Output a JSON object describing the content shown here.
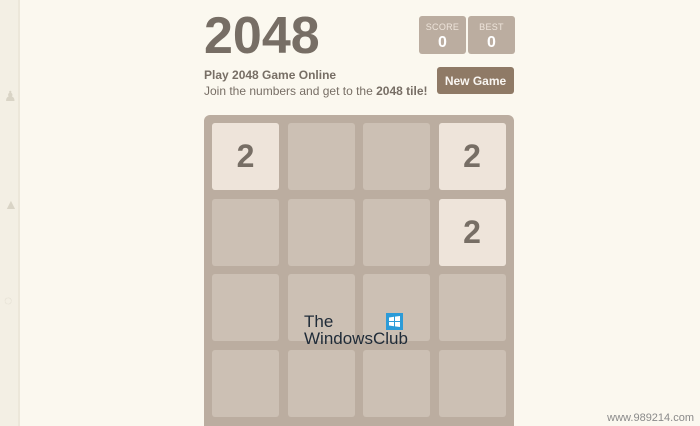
{
  "header": {
    "title": "2048",
    "score_label": "SCORE",
    "score_value": "0",
    "best_label": "BEST",
    "best_value": "0",
    "subtitle": "Play 2048 Game Online",
    "intro_prefix": "Join the numbers and get to the ",
    "intro_bold": "2048 tile!",
    "new_game_label": "New Game"
  },
  "board": {
    "rows": 4,
    "cols": 4,
    "tiles": [
      {
        "row": 0,
        "col": 0,
        "value": "2"
      },
      {
        "row": 0,
        "col": 3,
        "value": "2"
      },
      {
        "row": 1,
        "col": 3,
        "value": "2"
      }
    ]
  },
  "watermark": {
    "line1": "The",
    "line2": "WindowsClub"
  },
  "footer": {
    "url": "www.989214.com"
  },
  "colors": {
    "background": "#fbf8ef",
    "board": "#bbada0",
    "tile_2": "#eee4da",
    "text": "#776e65",
    "button": "#8f7a66"
  }
}
